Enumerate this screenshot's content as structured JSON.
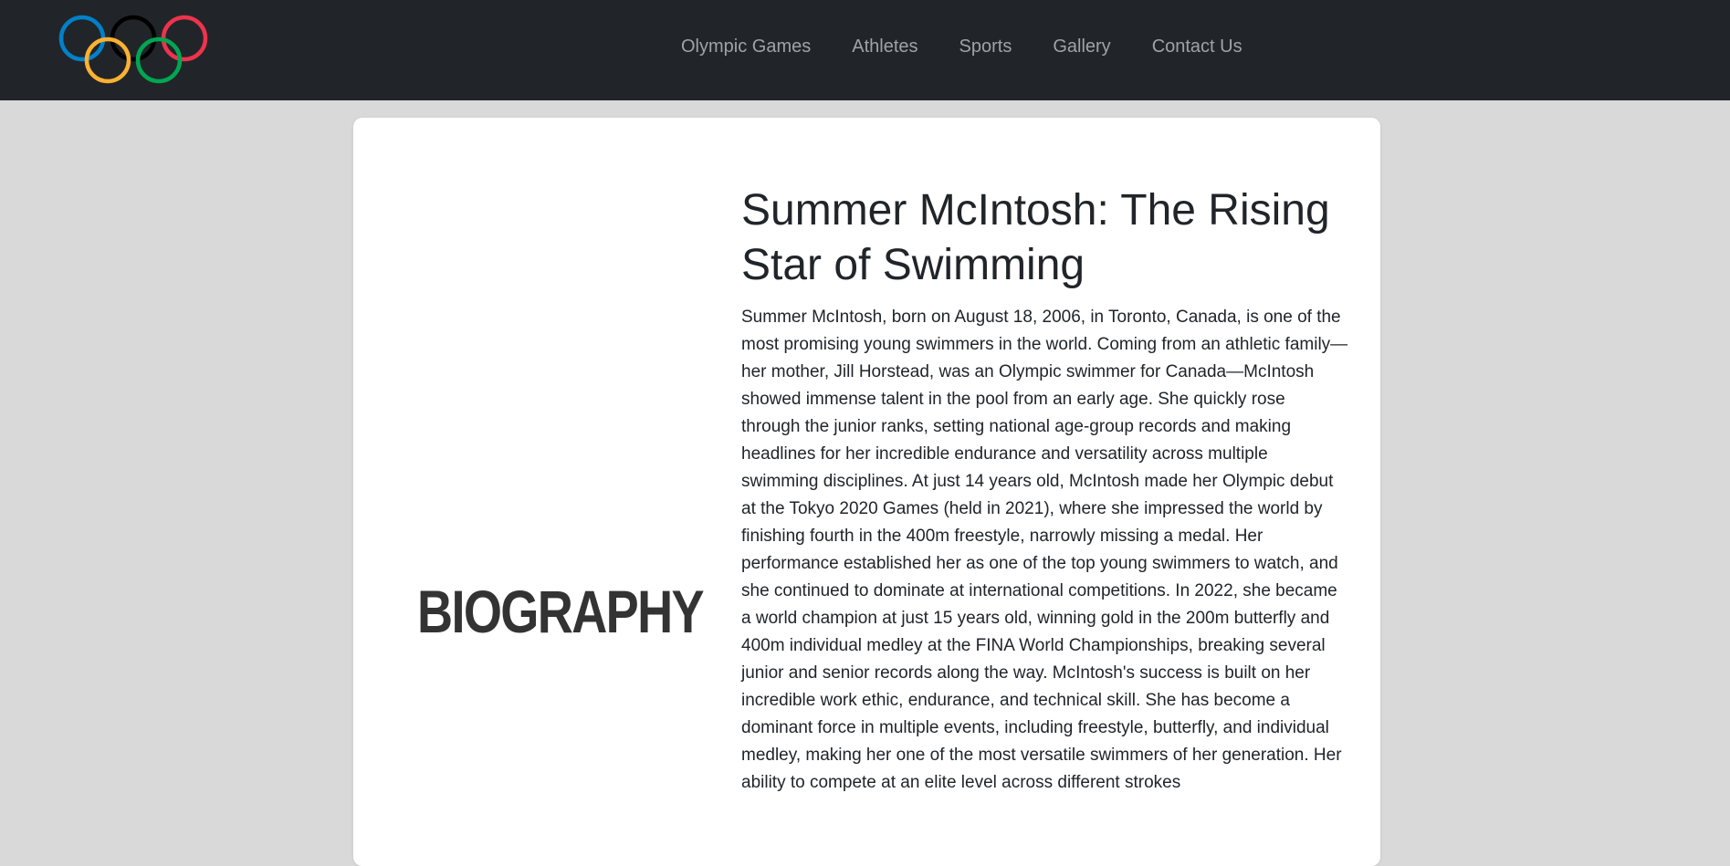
{
  "navbar": {
    "logo": "olympic-rings-logo",
    "ring_colors": [
      "#0081c8",
      "#000000",
      "#ee334e",
      "#fcb131",
      "#00a651"
    ],
    "links": [
      "Olympic Games",
      "Athletes",
      "Sports",
      "Gallery",
      "Contact Us"
    ]
  },
  "biography": {
    "section_label": "BIOGRAPHY",
    "title": "Summer McIntosh: The Rising Star of Swimming",
    "body": "Summer McIntosh, born on August 18, 2006, in Toronto, Canada, is one of the most promising young swimmers in the world. Coming from an athletic family—her mother, Jill Horstead, was an Olympic swimmer for Canada—McIntosh showed immense talent in the pool from an early age. She quickly rose through the junior ranks, setting national age-group records and making headlines for her incredible endurance and versatility across multiple swimming disciplines. At just 14 years old, McIntosh made her Olympic debut at the Tokyo 2020 Games (held in 2021), where she impressed the world by finishing fourth in the 400m freestyle, narrowly missing a medal. Her performance established her as one of the top young swimmers to watch, and she continued to dominate at international competitions. In 2022, she became a world champion at just 15 years old, winning gold in the 200m butterfly and 400m individual medley at the FINA World Championships, breaking several junior and senior records along the way. McIntosh's success is built on her incredible work ethic, endurance, and technical skill. She has become a dominant force in multiple events, including freestyle, butterfly, and individual medley, making her one of the most versatile swimmers of her generation. Her ability to compete at an elite level across different strokes"
  }
}
